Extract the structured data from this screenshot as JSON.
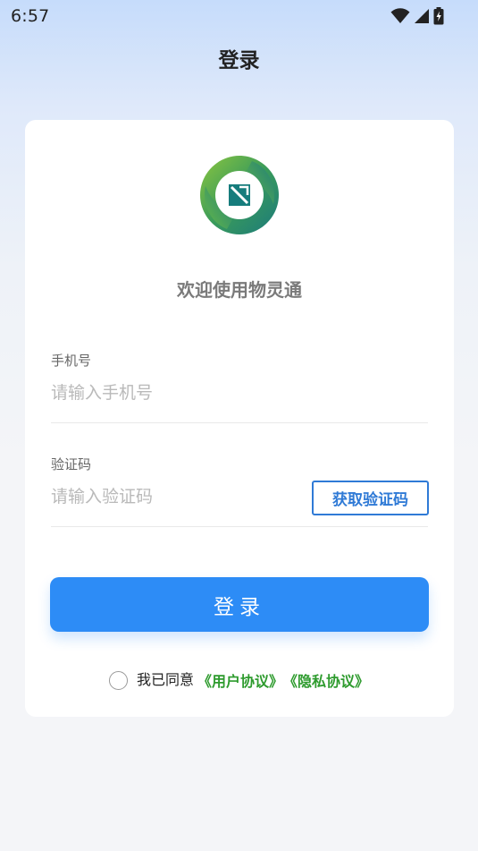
{
  "status_bar": {
    "time": "6:57",
    "icons": [
      "wifi-icon",
      "signal-icon",
      "battery-charging-icon"
    ]
  },
  "header": {
    "title": "登录"
  },
  "card": {
    "welcome": "欢迎使用物灵通",
    "phone": {
      "label": "手机号",
      "placeholder": "请输入手机号",
      "value": ""
    },
    "code": {
      "label": "验证码",
      "placeholder": "请输入验证码",
      "value": "",
      "button_label": "获取验证码"
    },
    "login_label": "登录",
    "agreement": {
      "checked": false,
      "prefix": "我已同意",
      "user_agreement": "《用户协议》",
      "privacy_policy": "《隐私协议》"
    }
  },
  "colors": {
    "primary": "#2d8cf6",
    "code_button": "#2f7ad6",
    "link": "#2e9b2e",
    "logo_green": "#4aa84a",
    "logo_teal": "#1a7a7a"
  }
}
